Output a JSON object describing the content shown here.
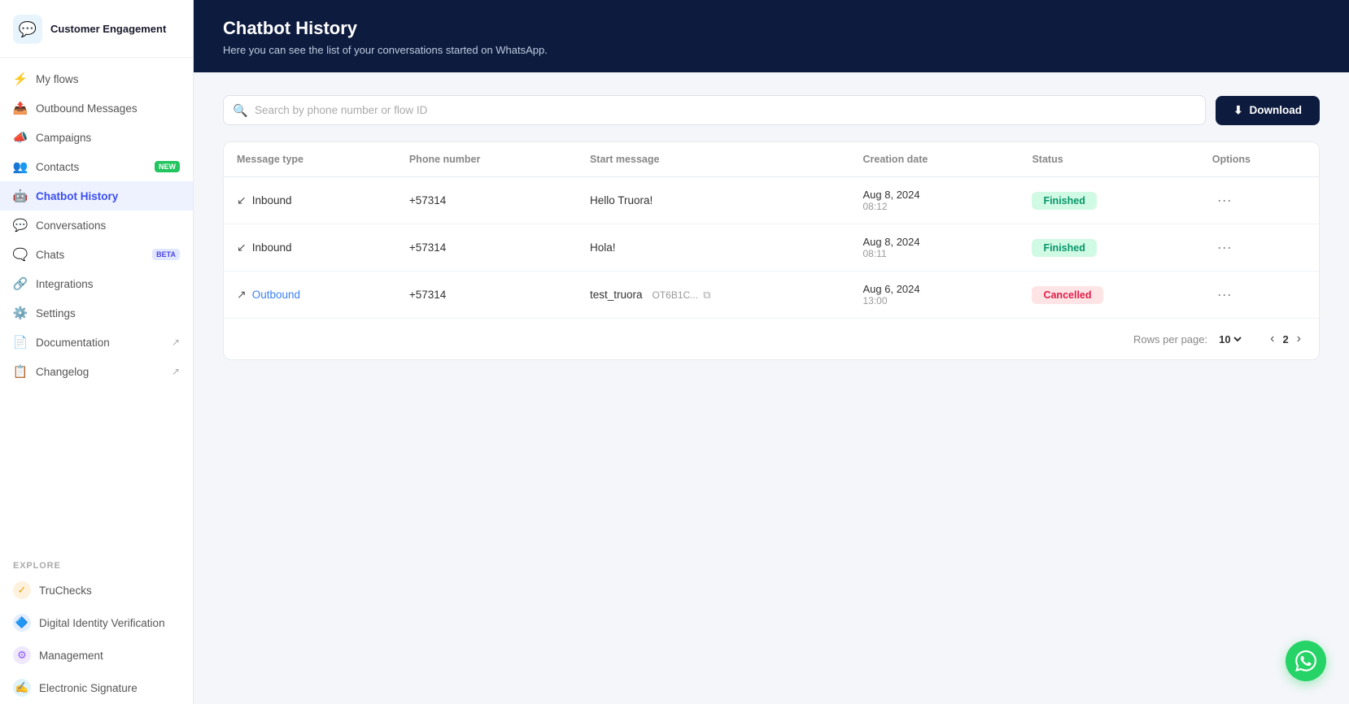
{
  "sidebar": {
    "brand": {
      "name": "Customer Engagement",
      "icon": "💬"
    },
    "nav_items": [
      {
        "id": "my-flows",
        "label": "My flows",
        "icon": "⚡",
        "badge": null,
        "active": false
      },
      {
        "id": "outbound-messages",
        "label": "Outbound Messages",
        "icon": "📤",
        "badge": null,
        "active": false
      },
      {
        "id": "campaigns",
        "label": "Campaigns",
        "icon": "📣",
        "badge": null,
        "active": false
      },
      {
        "id": "contacts",
        "label": "Contacts",
        "icon": "👥",
        "badge": "NEW",
        "active": false
      },
      {
        "id": "chatbot-history",
        "label": "Chatbot History",
        "icon": "🤖",
        "badge": null,
        "active": true
      },
      {
        "id": "conversations",
        "label": "Conversations",
        "icon": "💬",
        "badge": null,
        "active": false
      },
      {
        "id": "chats",
        "label": "Chats",
        "icon": "🗨️",
        "badge": "BETA",
        "active": false
      },
      {
        "id": "integrations",
        "label": "Integrations",
        "icon": "🔗",
        "badge": null,
        "active": false
      },
      {
        "id": "settings",
        "label": "Settings",
        "icon": "⚙️",
        "badge": null,
        "active": false
      },
      {
        "id": "documentation",
        "label": "Documentation",
        "icon": "📄",
        "badge": null,
        "active": false,
        "external": true
      },
      {
        "id": "changelog",
        "label": "Changelog",
        "icon": "📋",
        "badge": null,
        "active": false,
        "external": true
      }
    ],
    "explore_label": "Explore",
    "explore_items": [
      {
        "id": "truchecks",
        "label": "TruChecks",
        "color": "#f59e0b",
        "icon": "✓"
      },
      {
        "id": "digital-identity",
        "label": "Digital Identity Verification",
        "color": "#3b82f6",
        "icon": "🔷"
      },
      {
        "id": "management",
        "label": "Management",
        "color": "#8b5cf6",
        "icon": "⚙"
      },
      {
        "id": "electronic-signature",
        "label": "Electronic Signature",
        "color": "#0ea5e9",
        "icon": "✍"
      }
    ]
  },
  "header": {
    "title": "Chatbot History",
    "subtitle": "Here you can see the list of your conversations started on WhatsApp."
  },
  "toolbar": {
    "search_placeholder": "Search by phone number or flow ID",
    "download_label": "Download"
  },
  "table": {
    "columns": [
      "Message type",
      "Phone number",
      "Start message",
      "Creation date",
      "Status",
      "Options"
    ],
    "rows": [
      {
        "message_type": "Inbound",
        "type_direction": "inbound",
        "phone": "+57314",
        "start_message": "Hello Truora!",
        "start_message_truncated": null,
        "date": "Aug 8, 2024",
        "time": "08:12",
        "status": "Finished",
        "status_type": "finished"
      },
      {
        "message_type": "Inbound",
        "type_direction": "inbound",
        "phone": "+57314",
        "start_message": "Hola!",
        "start_message_truncated": null,
        "date": "Aug 8, 2024",
        "time": "08:11",
        "status": "Finished",
        "status_type": "finished"
      },
      {
        "message_type": "Outbound",
        "type_direction": "outbound",
        "phone": "+57314",
        "start_message": "test_truora",
        "start_message_truncated": "OT6B1C...",
        "date": "Aug 6, 2024",
        "time": "13:00",
        "status": "Cancelled",
        "status_type": "cancelled"
      }
    ]
  },
  "pagination": {
    "rows_per_page_label": "Rows per page:",
    "rows_per_page_value": "10",
    "current_page": "2"
  }
}
